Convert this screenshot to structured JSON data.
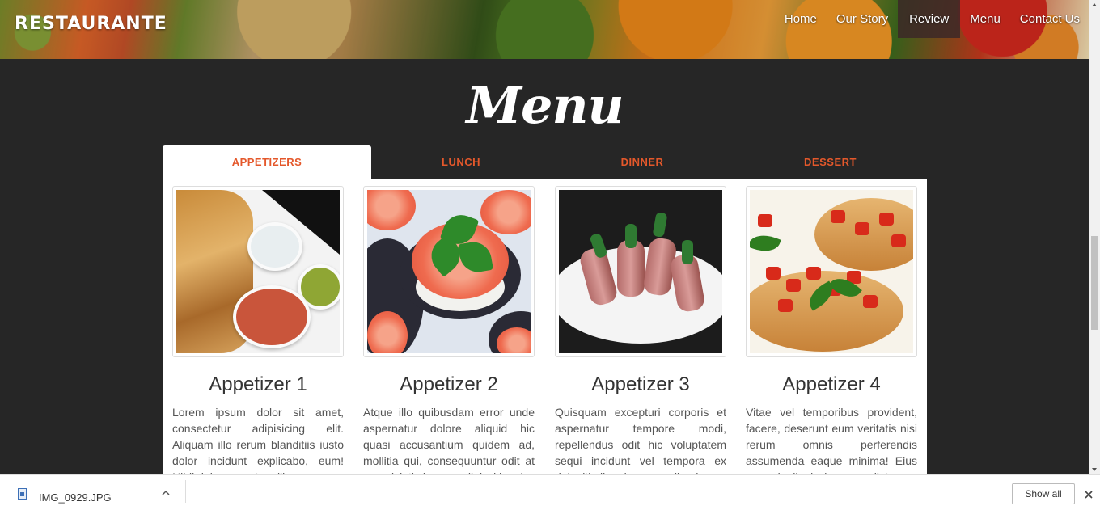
{
  "header": {
    "logo": "RESTAURANTE",
    "nav": [
      {
        "label": "Home",
        "active": false
      },
      {
        "label": "Our Story",
        "active": false
      },
      {
        "label": "Review",
        "active": true
      },
      {
        "label": "Menu",
        "active": false
      },
      {
        "label": "Contact Us",
        "active": false
      }
    ]
  },
  "menu": {
    "title": "Menu",
    "tabs": [
      {
        "label": "APPETIZERS",
        "active": true
      },
      {
        "label": "LUNCH",
        "active": false
      },
      {
        "label": "DINNER",
        "active": false
      },
      {
        "label": "DESSERT",
        "active": false
      }
    ],
    "items": [
      {
        "title": "Appetizer 1",
        "text": "Lorem ipsum dolor sit amet, consectetur adipisicing elit. Aliquam illo rerum blanditiis iusto dolor incidunt explicabo, eum! Nihil dolectus autem libero porro"
      },
      {
        "title": "Appetizer 2",
        "text": "Atque illo quibusdam error unde aspernatur dolore aliquid hic quasi accusantium quidem ad, mollitia qui, consequuntur odit at perspiciatis harum adipisci ipsa!"
      },
      {
        "title": "Appetizer 3",
        "text": "Quisquam excepturi corporis et aspernatur tempore modi, repellendus odit hic voluptatem sequi incidunt vel tempora ex deleniti ullam ipsa repudiandae"
      },
      {
        "title": "Appetizer 4",
        "text": "Vitae vel temporibus provident, facere, deserunt eum veritatis nisi rerum omnis perferendis assumenda eaque minima! Eius corporis dignissimos repellat"
      }
    ]
  },
  "download_bar": {
    "file_name": "IMG_0929.JPG",
    "show_all_label": "Show all"
  },
  "colors": {
    "accent": "#e4582b",
    "background": "#262626",
    "active_nav": "#3c2828"
  }
}
